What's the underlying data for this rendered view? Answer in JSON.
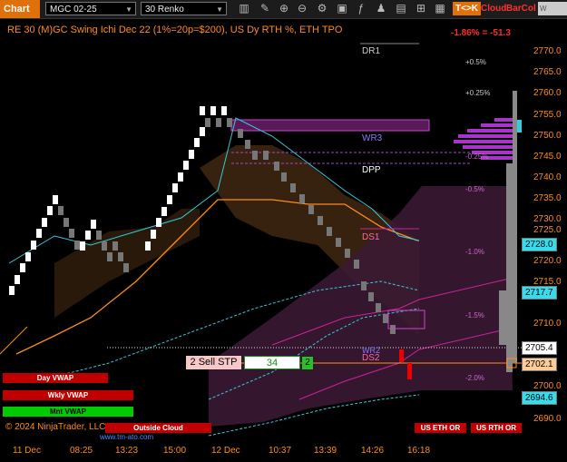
{
  "toolbar": {
    "tab_label": "Chart",
    "instrument": "MGC 02-25",
    "bar_type": "30 Renko",
    "mode_label": "T<>K",
    "cloud_label": "Cloud",
    "barcol_label": "BarCol",
    "wvw_label": "W VWAV",
    "icons": [
      "bar-type-icon",
      "draw-icon",
      "pointer-icon",
      "zoom-in-icon",
      "zoom-out-icon",
      "properties-icon",
      "template-icon",
      "indicator-icon",
      "strategy-icon",
      "dom-icon",
      "tile-icon",
      "layout-icon"
    ]
  },
  "header": {
    "title": "RE 30 (M)GC Swing Ichi Dec 22 (1%=20p=$200), US Dy RTH %, ETH TPO",
    "change": "-1.86% = -51.3"
  },
  "y_axis": {
    "labels": [
      "2770.0",
      "2765.0",
      "2760.0",
      "2755.0",
      "2750.0",
      "2745.0",
      "2740.0",
      "2735.0",
      "2730.0",
      "2725.0",
      "2720.0",
      "2715.0",
      "2710.0",
      "2700.0",
      "2690.0"
    ],
    "tags": [
      {
        "value": "2728.0",
        "style": "cyan"
      },
      {
        "value": "2717.7",
        "style": "cyan"
      },
      {
        "value": "2705.4",
        "style": "white"
      },
      {
        "value": "2702.1",
        "style": "orange"
      },
      {
        "value": "2694.6",
        "style": "cyan"
      }
    ]
  },
  "x_axis": {
    "labels": [
      "11 Dec",
      "08:25",
      "13:23",
      "15:00",
      "12 Dec",
      "10:37",
      "13:39",
      "14:26",
      "16:18"
    ]
  },
  "pivots": {
    "dr1": "DR1",
    "wr3": "WR3",
    "dpp": "DPP",
    "ds1": "DS1",
    "wr2": "WR2",
    "ds2": "DS2"
  },
  "percent_levels": [
    "+0.5%",
    "+0.25%",
    "-0.25%",
    "-0.5%",
    "-1.0%",
    "-1.5%",
    "-2.0%"
  ],
  "vwap_buttons": {
    "day": "Day VWAP",
    "weekly": "Wkly VWAP",
    "monthly": "Mnt VWAP"
  },
  "order": {
    "label": "2 Sell STP",
    "quantity": "34",
    "count": "2"
  },
  "footer": {
    "copyright": "© 2024 NinjaTrader, LLC",
    "outside_cloud": "Outside Cloud",
    "eth_or": "US ETH OR",
    "rth_or": "US RTH OR",
    "watermark": "www.tm-ato.com"
  },
  "colors": {
    "axis": "#ff8c1a",
    "accent_orange": "#e0700a",
    "cyan": "#33ccdd",
    "magenta": "#cc2299"
  }
}
